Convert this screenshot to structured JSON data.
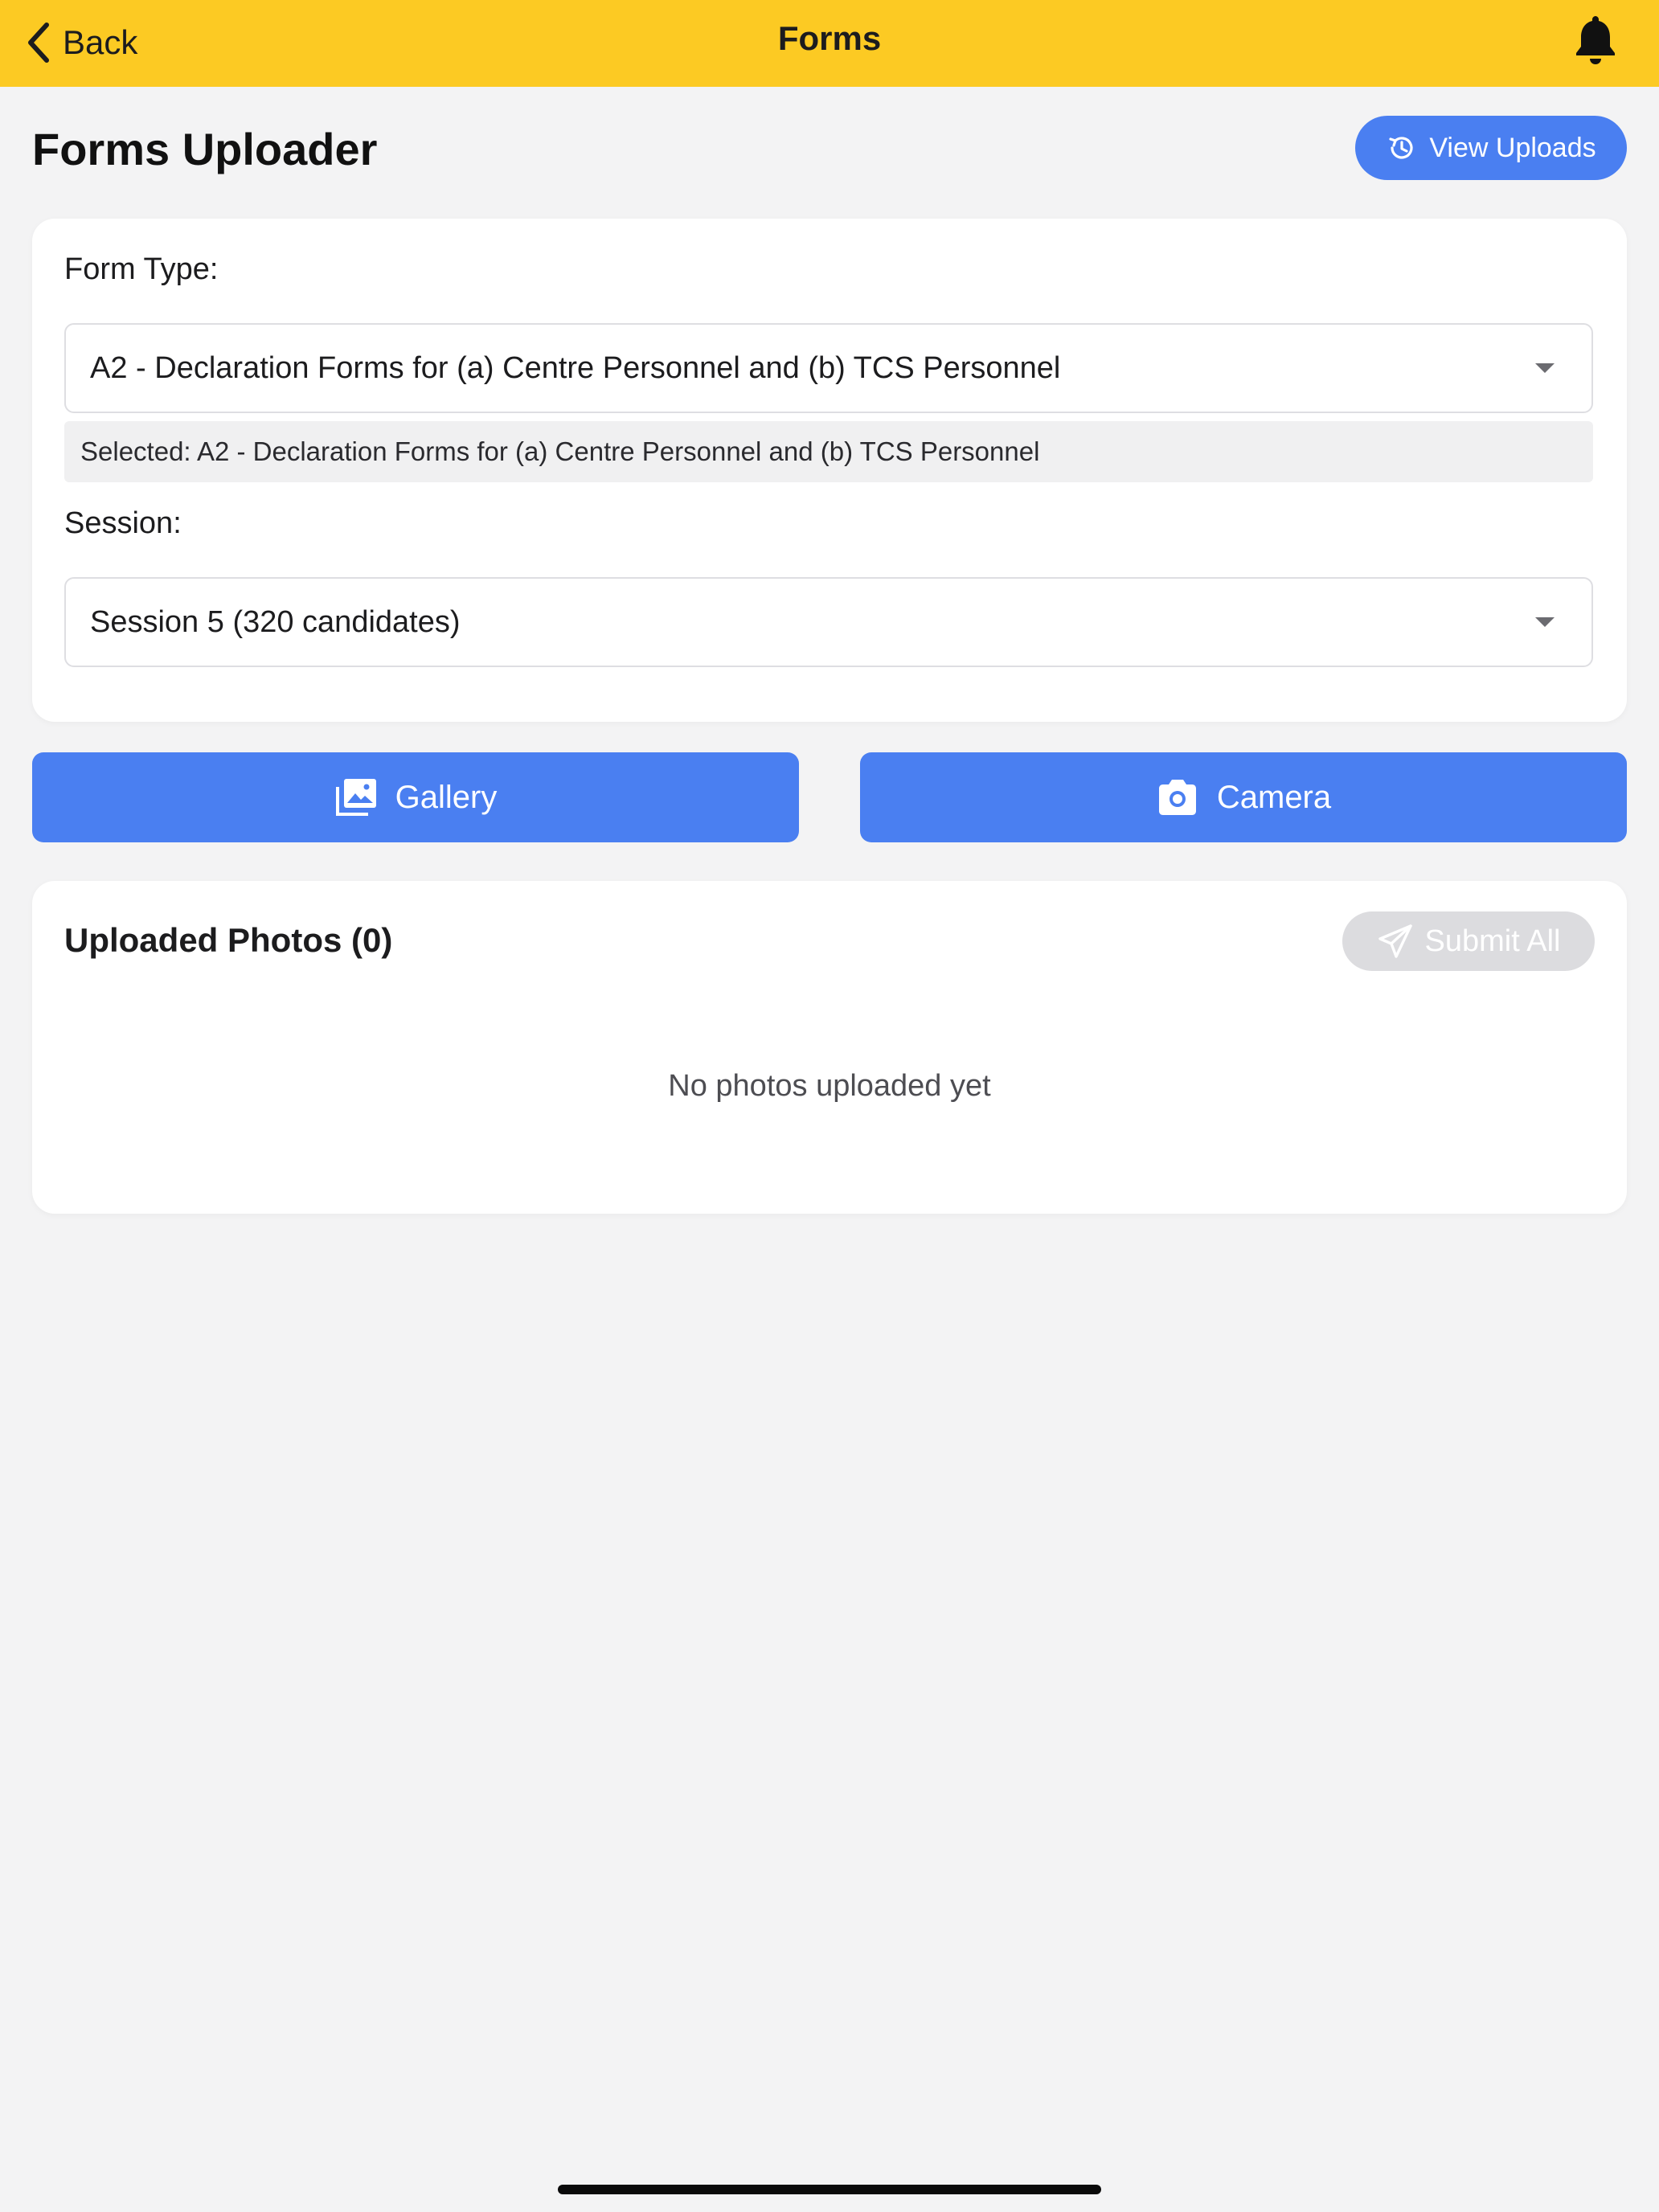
{
  "nav": {
    "back_label": "Back",
    "title": "Forms",
    "bar_color": "#fcca23",
    "bell_icon": "bell-icon"
  },
  "header": {
    "page_title": "Forms Uploader",
    "view_uploads_label": "View Uploads"
  },
  "form": {
    "form_type_label": "Form Type:",
    "form_type_value": "A2 - Declaration Forms for (a) Centre Personnel and (b) TCS Personnel",
    "selected_note": "Selected: A2 - Declaration Forms for (a) Centre Personnel and (b) TCS Personnel",
    "session_label": "Session:",
    "session_value": "Session 5 (320 candidates)"
  },
  "actions": {
    "gallery_label": "Gallery",
    "camera_label": "Camera",
    "accent_color": "#4a7ff1"
  },
  "photos": {
    "title": "Uploaded Photos (0)",
    "submit_all_label": "Submit All",
    "empty_text": "No photos uploaded yet"
  }
}
